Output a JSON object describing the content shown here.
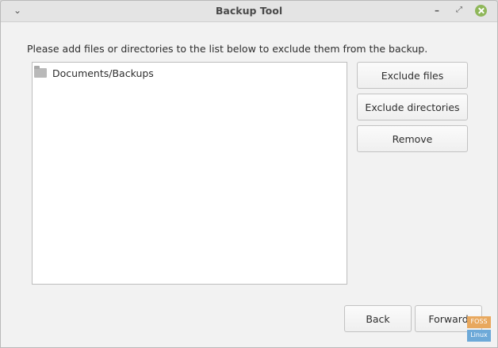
{
  "window": {
    "title": "Backup Tool",
    "menu_icon": "chevron-down-icon",
    "minimize_icon": "minimize-icon",
    "maximize_icon": "maximize-icon",
    "close_icon": "close-icon"
  },
  "content": {
    "instruction": "Please add files or directories to the list below to exclude them from the backup.",
    "list_items": [
      {
        "label": "Documents/Backups",
        "icon": "folder-icon"
      }
    ]
  },
  "buttons": {
    "exclude_files": "Exclude files",
    "exclude_directories": "Exclude directories",
    "remove": "Remove",
    "back": "Back",
    "forward": "Forward"
  },
  "watermark": {
    "top": "FOSS",
    "bottom": "Linux"
  },
  "colors": {
    "close_button": "#8fb75a",
    "window_bg": "#f2f2f2",
    "titlebar_bg": "#e4e4e4"
  }
}
